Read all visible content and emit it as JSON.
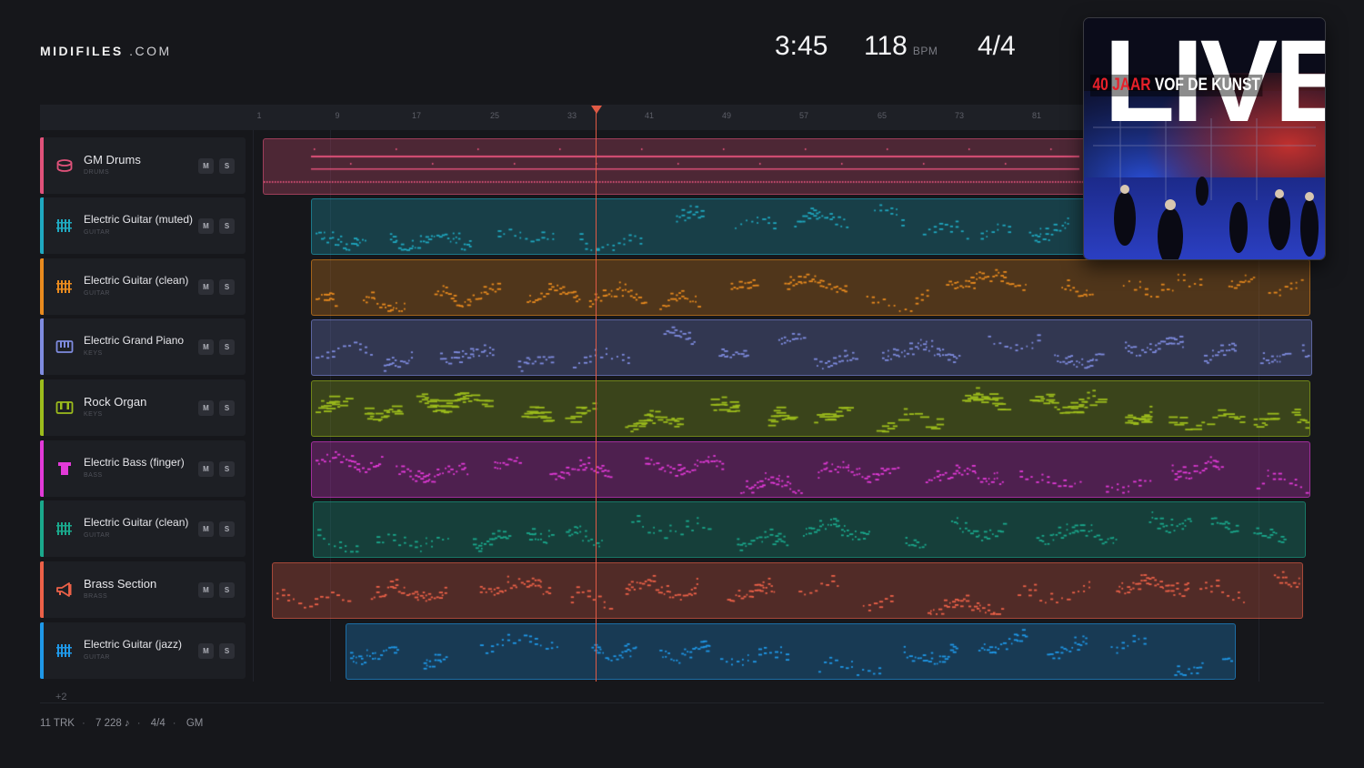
{
  "brand": {
    "name": "MIDIFILES",
    "suffix": ".COM"
  },
  "header": {
    "duration": "3:45",
    "tempo": "118",
    "tempo_unit": "BPM",
    "time_signature": "4/4"
  },
  "ruler": {
    "bars": [
      "1",
      "9",
      "17",
      "25",
      "33",
      "41",
      "49",
      "57",
      "65",
      "73",
      "81"
    ]
  },
  "tracks": [
    {
      "name": "GM Drums",
      "category": "DRUMS",
      "color": "#e0527a",
      "icon": "drum-icon"
    },
    {
      "name": "Electric Guitar (muted)",
      "category": "GUITAR",
      "color": "#1fa8c0",
      "icon": "guitar-fretboard-icon"
    },
    {
      "name": "Electric Guitar (clean)",
      "category": "GUITAR",
      "color": "#e88a1e",
      "icon": "guitar-fretboard-icon"
    },
    {
      "name": "Electric Grand Piano",
      "category": "KEYS",
      "color": "#7f8ce0",
      "icon": "piano-keys-icon"
    },
    {
      "name": "Rock Organ",
      "category": "KEYS",
      "color": "#9cbc1c",
      "icon": "organ-keys-icon"
    },
    {
      "name": "Electric Bass (finger)",
      "category": "BASS",
      "color": "#e23ad8",
      "icon": "bass-icon"
    },
    {
      "name": "Electric Guitar (clean)",
      "category": "GUITAR",
      "color": "#1aa88c",
      "icon": "guitar-fretboard-icon"
    },
    {
      "name": "Brass Section",
      "category": "BRASS",
      "color": "#ec6148",
      "icon": "trumpet-icon"
    },
    {
      "name": "Electric Guitar (jazz)",
      "category": "GUITAR",
      "color": "#1f98e8",
      "icon": "guitar-fretboard-icon"
    }
  ],
  "buttons": {
    "mute": "M",
    "solo": "S"
  },
  "more_tracks": "+2",
  "footer": {
    "tracks": "11 TRK",
    "notes": "7 228 ♪",
    "time_signature": "4/4",
    "standard": "GM"
  },
  "album": {
    "title": "LIVE",
    "subtitle_red": "40 JAAR",
    "subtitle_white": "VOF DE KUNST"
  }
}
